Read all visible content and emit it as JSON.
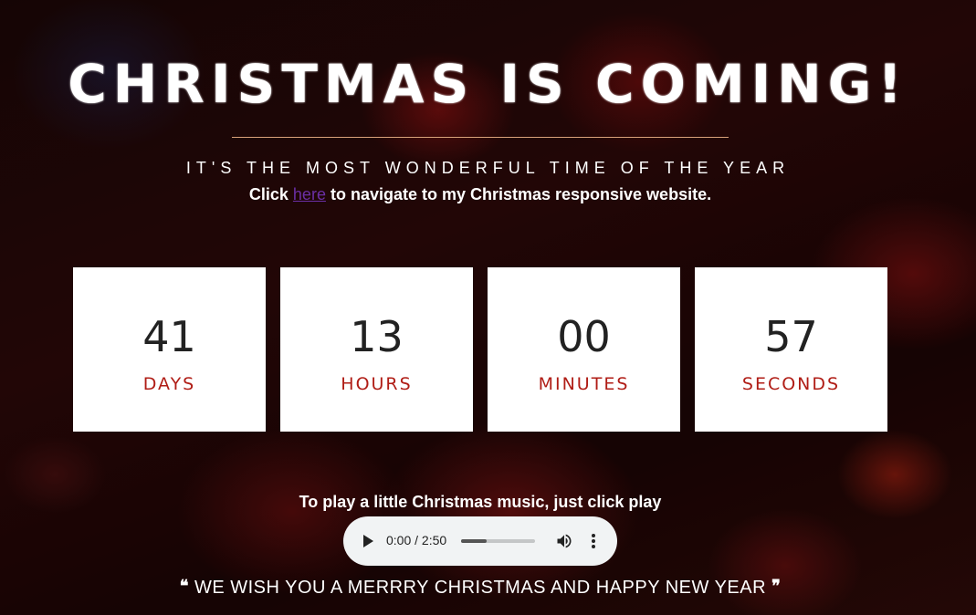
{
  "header": {
    "title": "CHRISTMAS IS COMING!",
    "subtitle": "IT'S THE MOST WONDERFUL TIME OF THE YEAR",
    "nav_prefix": "Click ",
    "nav_link": "here",
    "nav_suffix": " to navigate to my Christmas responsive website."
  },
  "countdown": [
    {
      "value": "41",
      "label": "DAYS"
    },
    {
      "value": "13",
      "label": "HOURS"
    },
    {
      "value": "00",
      "label": "MINUTES"
    },
    {
      "value": "57",
      "label": "SECONDS"
    }
  ],
  "music": {
    "prompt": "To play a little Christmas music, just click play",
    "player": {
      "time": "0:00 / 2:50",
      "progress": 0.35,
      "play_icon": "play-icon",
      "volume_icon": "volume-icon",
      "menu_icon": "more-vert-icon"
    }
  },
  "footer": {
    "open_quote": "❝",
    "message": "WE WISH YOU A MERRRY CHRISTMAS AND HAPPY NEW YEAR",
    "close_quote": "❞"
  },
  "colors": {
    "label_red": "#b01d16",
    "link_purple": "#6b2fa6",
    "divider": "#d9a27a"
  }
}
